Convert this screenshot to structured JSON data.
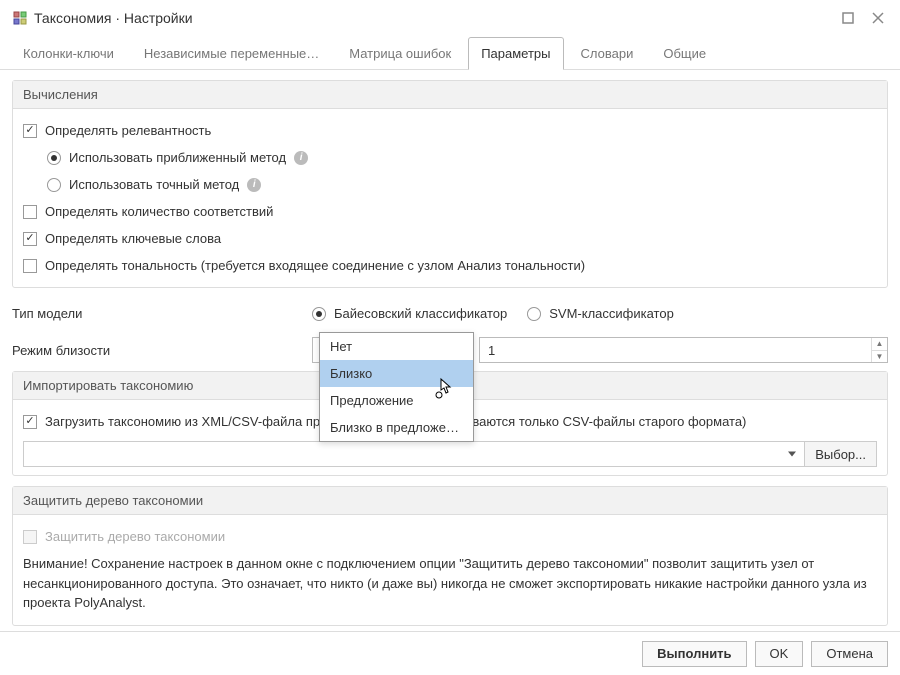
{
  "window": {
    "title": "Таксономия · Настройки"
  },
  "tabs": {
    "t0": "Колонки-ключи",
    "t1": "Независимые переменные…",
    "t2": "Матрица ошибок",
    "t3": "Параметры",
    "t4": "Словари",
    "t5": "Общие"
  },
  "groups": {
    "calculations": "Вычисления",
    "import": "Импортировать таксономию",
    "protect": "Защитить дерево таксономии"
  },
  "calc": {
    "relevance": "Определять релевантность",
    "approx": "Использовать приближенный метод",
    "exact": "Использовать точный метод",
    "matches": "Определять количество соответствий",
    "keywords": "Определять ключевые слова",
    "tonality": "Определять тональность (требуется входящее соединение с узлом Анализ тональности)"
  },
  "model": {
    "label": "Тип модели",
    "bayes": "Байесовский классификатор",
    "svm": "SVM-классификатор"
  },
  "proximity": {
    "label": "Режим близости",
    "selected": "Близко",
    "number": "1",
    "options": {
      "o0": "Нет",
      "o1": "Близко",
      "o2": "Предложение",
      "o3": "Близко в предложен..."
    }
  },
  "import": {
    "label": "Загрузить таксономию из XML/CSV-файла при выполнении (поддерживаются только CSV-файлы старого формата)",
    "browse": "Выбор..."
  },
  "protect": {
    "label": "Защитить дерево таксономии",
    "warning": "Внимание! Сохранение настроек в данном окне с подключением опции \"Защитить дерево таксономии\" позволит защитить узел от несанкционированного доступа. Это означает, что никто (и даже вы) никогда не сможет экспортировать никакие настройки данного узла из проекта PolyAnalyst."
  },
  "footer": {
    "run": "Выполнить",
    "ok": "OK",
    "cancel": "Отмена"
  },
  "info": "i"
}
